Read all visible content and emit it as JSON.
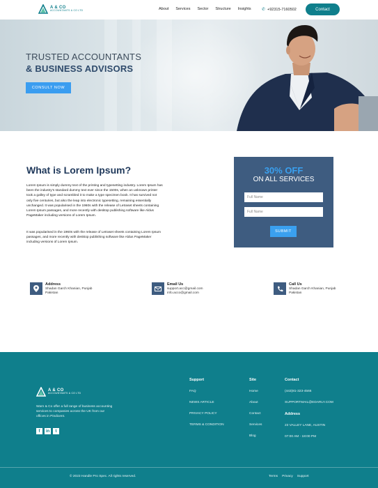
{
  "brand": {
    "name": "A & CO",
    "tagline": "ACCOUNTANTS & CO LTD",
    "accent": "#0f7f8c",
    "navy": "#3e5c80",
    "blue": "#3aa0ef"
  },
  "nav": {
    "links": [
      "About",
      "Services",
      "Sector",
      "Structure",
      "Insights"
    ],
    "phone": "+92315-7160502",
    "contact_label": "Contact"
  },
  "hero": {
    "title_line1": "TRUSTED ACCOUNTANTS",
    "title_line2": "& BUSINESS ADVISORS",
    "cta_label": "CONSULT NOW"
  },
  "about": {
    "title": "What is Lorem Ipsum?",
    "para1": "Lorem Ipsum is simply dummy text of the printing and typesetting industry. Lorem Ipsum has been the industry's standard dummy text ever since the 1500s, when an unknown printer took a galley of type and scrambled it to make a type specimen book. It has survived not only five centuries, but also the leap into electronic typesetting, remaining essentially unchanged. It was popularised in the 1960s with the release of Letraset sheets containing Lorem Ipsum passages, and more recently with desktop publishing software like Aldus PageMaker including versions of Lorem Ipsum.",
    "para2": "It was popularised in the 1960s with the release of Letraset sheets containing Lorem Ipsum passages, and more recently with desktop publishing software like Aldus PageMaker including versions of Lorem Ipsum."
  },
  "offer": {
    "percent": "30% OFF",
    "subtitle": "ON ALL SERVICES",
    "name_placeholder": "Full Name",
    "email_placeholder": "Full Name",
    "submit_label": "SUBMIT"
  },
  "info": {
    "address": {
      "heading": "Address",
      "line1": "Shadan Garch Khanian, Punjab",
      "line2": "Pakistan"
    },
    "email": {
      "heading": "Email Us",
      "line1": "support.acc@gmail.com",
      "line2": "info.acco@gmail.com"
    },
    "call": {
      "heading": "Call Us",
      "line1": "Shadan Garch Khanian, Punjab",
      "line2": "Pakistan"
    }
  },
  "footer": {
    "description": "Warn & Co offer a full range of business accounting services to companies across the UK from our offices in Pindicent.",
    "social": [
      "f",
      "in",
      "t"
    ],
    "support": {
      "heading": "Support",
      "items": [
        "FAQ",
        "NEWS ARTICLE",
        "PRIVACY POLICY",
        "TERMS & CONDITION"
      ]
    },
    "site": {
      "heading": "Site",
      "items": [
        "Home",
        "About",
        "Contact",
        "Services",
        "Blog"
      ]
    },
    "contact": {
      "heading": "Contact",
      "phone": "(443)81-323-4566",
      "email": "SUPPORTMAIL@EDARLY.COM",
      "address_heading": "Address",
      "address": "23 VALLEY LANE, AUSTIN",
      "hours": "07:00 AM - 18:00 PM"
    },
    "copyright": "© 2023 Handle Pro Spec. All rights reserved.",
    "legal": [
      "Terms",
      "Privacy",
      "Support"
    ]
  }
}
